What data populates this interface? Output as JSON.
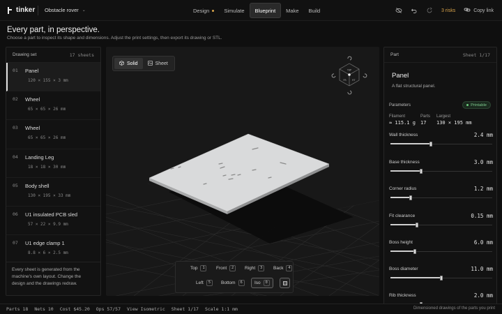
{
  "topbar": {
    "brand": "tinker",
    "project": "Obstacle rover",
    "nav": [
      {
        "label": "Design",
        "dot": true
      },
      {
        "label": "Simulate",
        "dot": false
      },
      {
        "label": "Blueprint",
        "dot": false,
        "active": true
      },
      {
        "label": "Make",
        "dot": false
      },
      {
        "label": "Build",
        "dot": false
      }
    ],
    "risks": "3 risks",
    "copy_link": "Copy link"
  },
  "header": {
    "title": "Every part, in perspective.",
    "subtitle": "Choose a part to inspect its shape and dimensions. Adjust the print settings, then export its drawing or STL."
  },
  "drawing_set": {
    "label": "Drawing set",
    "count": "17 sheets",
    "items": [
      {
        "num": "01",
        "name": "Panel",
        "dims": "120 × 155 × 3 mm"
      },
      {
        "num": "02",
        "name": "Wheel",
        "dims": "65 × 65 × 26 mm"
      },
      {
        "num": "03",
        "name": "Wheel",
        "dims": "65 × 65 × 26 mm"
      },
      {
        "num": "04",
        "name": "Landing Leg",
        "dims": "18 × 18 × 30 mm"
      },
      {
        "num": "05",
        "name": "Body shell",
        "dims": "130 × 195 × 33 mm"
      },
      {
        "num": "06",
        "name": "U1 insulated PCB sled",
        "dims": "57 × 22 × 9.9 mm"
      },
      {
        "num": "07",
        "name": "U1 edge clamp 1",
        "dims": "8.8 × 6 × 2.5 mm"
      }
    ],
    "footer": "Every sheet is generated from the machine's own layout. Change the design and the drawings redraw."
  },
  "viewport": {
    "modes": [
      {
        "label": "Solid",
        "icon": "cube-icon",
        "active": true
      },
      {
        "label": "Sheet",
        "icon": "sheet-icon",
        "active": false
      }
    ],
    "viewcube_faces": [
      "TOP",
      "FR",
      "RT"
    ],
    "views": [
      {
        "label": "Top",
        "key": "1"
      },
      {
        "label": "Front",
        "key": "2"
      },
      {
        "label": "Right",
        "key": "3"
      },
      {
        "label": "Back",
        "key": "4"
      },
      {
        "label": "Left",
        "key": "5"
      },
      {
        "label": "Bottom",
        "key": "6"
      },
      {
        "label": "Iso",
        "key": "0",
        "active": true
      }
    ]
  },
  "part": {
    "label": "Part",
    "sheet": "Sheet 1/17",
    "title": "Panel",
    "description": "A flat structural panel.",
    "params_label": "Parameters",
    "status": "Printable",
    "stats": [
      {
        "label": "Filament",
        "value": "≈ 115.1 g"
      },
      {
        "label": "Parts",
        "value": "17"
      },
      {
        "label": "Largest",
        "value": "130 × 195 mm"
      }
    ],
    "params": [
      {
        "label": "Wall thickness",
        "value": "2.4 mm",
        "fraction": 0.4
      },
      {
        "label": "Base thickness",
        "value": "3.0 mm",
        "fraction": 0.3
      },
      {
        "label": "Corner radius",
        "value": "1.2 mm",
        "fraction": 0.2
      },
      {
        "label": "Fit clearance",
        "value": "0.15 mm",
        "fraction": 0.26
      },
      {
        "label": "Boss height",
        "value": "6.0 mm",
        "fraction": 0.24
      },
      {
        "label": "Boss diameter",
        "value": "11.0 mm",
        "fraction": 0.5
      },
      {
        "label": "Rib thickness",
        "value": "2.0 mm",
        "fraction": 0.3
      }
    ]
  },
  "statusbar": {
    "parts": "Parts 18",
    "nets": "Nets 10",
    "cost": "Cost $45.20",
    "ops": "Ops 57/57",
    "view": "View Isometric",
    "sheet": "Sheet 1/17",
    "scale": "Scale 1:1 mm",
    "note": "Dimensioned drawings of the parts you print"
  }
}
